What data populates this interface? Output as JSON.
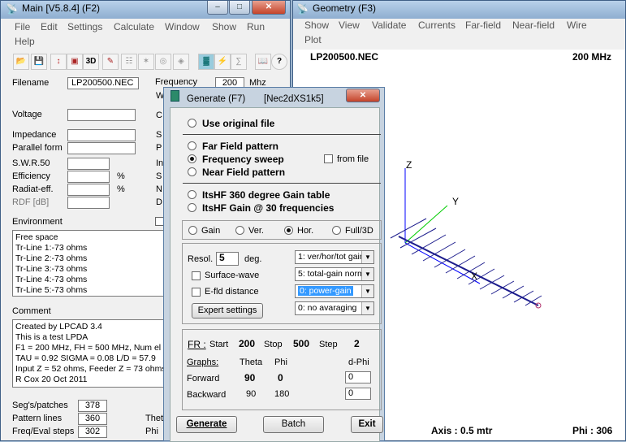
{
  "main": {
    "title": "Main [V5.8.4]  (F2)",
    "menu": [
      "File",
      "Edit",
      "Settings",
      "Calculate",
      "Window",
      "Show",
      "Run",
      "Help"
    ],
    "toolbar_icons": [
      "folder-open-icon",
      "floppy-icon",
      "antenna-icon",
      "cube-icon",
      "3d-icon",
      "edit-icon",
      "grid-icon",
      "pattern-icon",
      "globe-icon",
      "speaker-icon",
      "calculator-icon",
      "lightning-icon",
      "book-icon",
      "help-icon"
    ],
    "toolbar_text": {
      "3d": "3D",
      "help": "?"
    },
    "labels": {
      "filename": "Filename",
      "frequency": "Frequency",
      "freq_unit": "Mhz",
      "voltage": "Voltage",
      "impedance": "Impedance",
      "parallel": "Parallel form",
      "swr": "S.W.R.50",
      "efficiency": "Efficiency",
      "radiat": "Radiat-eff.",
      "rdf": "RDF [dB]",
      "environment": "Environment",
      "comment": "Comment",
      "segs": "Seg's/patches",
      "pattern_lines": "Pattern lines",
      "freq_eval": "Freq/Eval steps",
      "pct": "%",
      "pct2": "%"
    },
    "filename_value": "LP200500.NEC",
    "frequency_value": "200",
    "environment_lines": [
      "Free space",
      "Tr-Line  1:-73 ohms",
      "Tr-Line  2:-73 ohms",
      "Tr-Line  3:-73 ohms",
      "Tr-Line  4:-73 ohms",
      "Tr-Line  5:-73 ohms"
    ],
    "comment_lines": [
      "Created by LPCAD 3.4",
      "This is a test LPDA",
      "F1 = 200 MHz, FH = 500 MHz, Num el",
      "TAU = 0.92 SIGMA = 0.08 L/D = 57.9",
      "Input Z = 52 ohms, Feeder Z = 73 ohms",
      "R Cox 20 Oct 2011"
    ],
    "segs_value": "378",
    "pattern_lines_value": "360",
    "freq_eval_value": "302",
    "partial_labels": [
      "W",
      "C",
      "S",
      "P",
      "In",
      "S",
      "N",
      "D",
      "Thet",
      "Phi"
    ]
  },
  "geometry": {
    "title": "Geometry  (F3)",
    "menu": [
      "Show",
      "View",
      "Validate",
      "Currents",
      "Far-field",
      "Near-field",
      "Wire",
      "Plot"
    ],
    "filename": "LP200500.NEC",
    "freq": "200 MHz",
    "axis_z": "Z",
    "axis_y": "Y",
    "axis_x": "X",
    "axis_info": "Axis : 0.5 mtr",
    "phi_info": "Phi : 306"
  },
  "generate": {
    "title": "Generate  (F7)",
    "subtitle": "[Nec2dXS1k5]",
    "use_original": "Use original file",
    "far_field": "Far Field pattern",
    "freq_sweep": "Frequency sweep",
    "from_file": "from file",
    "near_field": "Near Field pattern",
    "itshf_360": "ItsHF 360 degree Gain table",
    "itshf_30": "ItsHF Gain @ 30 frequencies",
    "pol": [
      "Gain",
      "Ver.",
      "Hor.",
      "Full/3D"
    ],
    "resol_label": "Resol.",
    "resol_value": "5",
    "deg": "deg.",
    "surface_wave": "Surface-wave",
    "efld": "E-fld distance",
    "expert": "Expert settings",
    "selects": [
      "1: ver/hor/tot gain",
      "5: total-gain norm",
      "0: power-gain",
      "0: no avaraging"
    ],
    "fr_label": "FR :",
    "start_label": "Start",
    "start_value": "200",
    "stop_label": "Stop",
    "stop_value": "500",
    "step_label": "Step",
    "step_value": "2",
    "graphs": "Graphs:",
    "theta": "Theta",
    "phi": "Phi",
    "dphi": "d-Phi",
    "forward": "Forward",
    "forward_theta": "90",
    "forward_phi": "0",
    "forward_dphi": "0",
    "backward": "Backward",
    "backward_theta": "90",
    "backward_phi": "180",
    "backward_dphi": "0",
    "btn_generate": "Generate",
    "btn_batch": "Batch",
    "btn_exit": "Exit"
  },
  "colors": {
    "title_bar": "#b9d1ea",
    "selection": "#3399ff",
    "antenna": "#1c1c8c",
    "axis_green": "#00c000",
    "axis_blue": "#0000ff"
  }
}
